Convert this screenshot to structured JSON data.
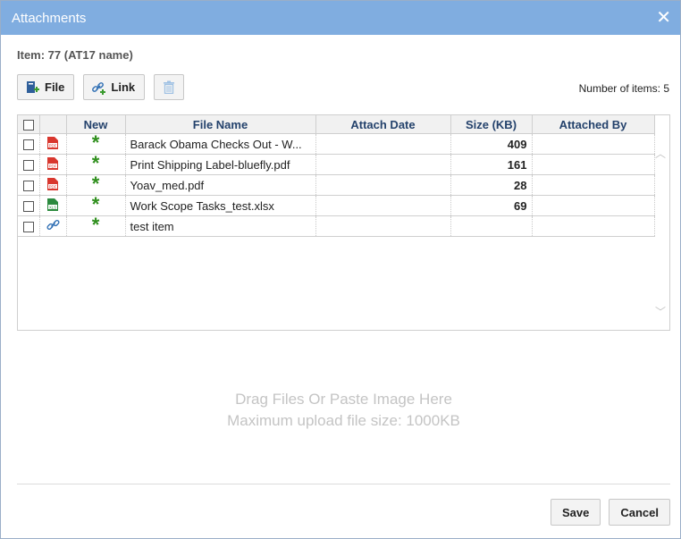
{
  "dialog": {
    "title": "Attachments",
    "item_label": "Item: 77 (AT17 name)"
  },
  "toolbar": {
    "file_label": "File",
    "link_label": "Link",
    "count_label": "Number of items: 5"
  },
  "table": {
    "headers": [
      "New",
      "File Name",
      "Attach Date",
      "Size (KB)",
      "Attached By"
    ],
    "rows": [
      {
        "icon": "pdf-icon",
        "name": "Barack Obama Checks Out - W...",
        "date": "",
        "size": "409",
        "by": ""
      },
      {
        "icon": "pdf-icon",
        "name": "Print Shipping Label-bluefly.pdf",
        "date": "",
        "size": "161",
        "by": ""
      },
      {
        "icon": "pdf-icon",
        "name": "Yoav_med.pdf",
        "date": "",
        "size": "28",
        "by": ""
      },
      {
        "icon": "xlsx-icon",
        "name": "Work Scope Tasks_test.xlsx",
        "date": "",
        "size": "69",
        "by": ""
      },
      {
        "icon": "link-icon",
        "name": "test item",
        "date": "",
        "size": "",
        "by": ""
      }
    ]
  },
  "dropzone": {
    "line1": "Drag Files Or Paste Image Here",
    "line2": "Maximum upload file size: 1000KB"
  },
  "footer": {
    "save_label": "Save",
    "cancel_label": "Cancel"
  },
  "colors": {
    "titlebar": "#80ade0",
    "header_text": "#24426c",
    "new_star": "#2f8f1d",
    "pdf": "#d9372e",
    "xlsx": "#2b8a3e"
  }
}
